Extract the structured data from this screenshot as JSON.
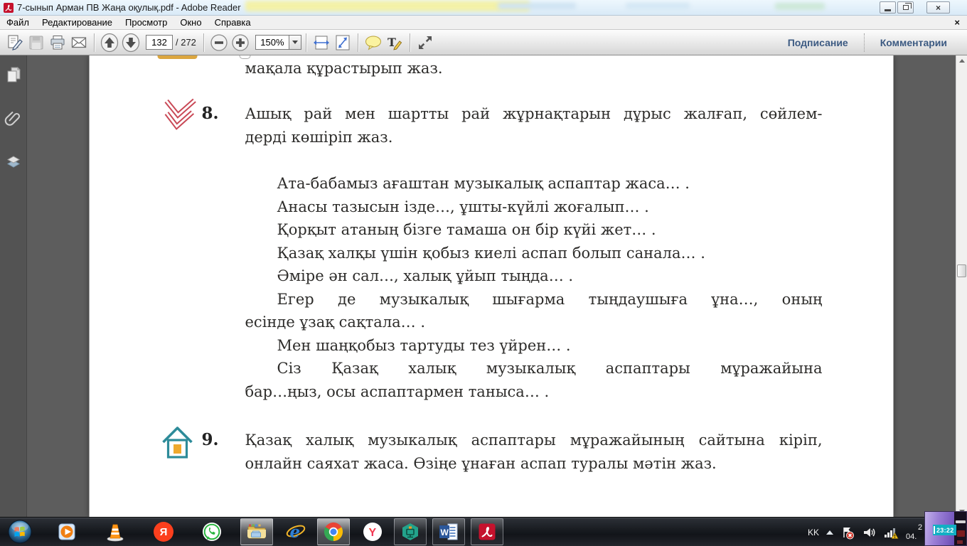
{
  "window": {
    "title": "7-сынып Арман ПВ Жаңа оқулық.pdf - Adobe Reader",
    "close_glyph": "×"
  },
  "menu": {
    "items": [
      "Файл",
      "Редактирование",
      "Просмотр",
      "Окно",
      "Справка"
    ],
    "close_glyph": "×"
  },
  "toolbar": {
    "page_current": "132",
    "page_total": "/ 272",
    "zoom_level": "150%",
    "signing_label": "Подписание",
    "comments_label": "Комментарии"
  },
  "document": {
    "partial_top_line": "мақала құрастырып жаз.",
    "exercise8": {
      "number": "8.",
      "intro": [
        {
          "text": "Ашық рай мен шартты рай жұрнақтарын дұрыс жалғап, сөйлем-"
        },
        {
          "text": "дерді көшіріп жаз."
        }
      ],
      "sentences": [
        {
          "text": "Ата-бабамыз ағаштан музыкалық аспаптар жаса… ."
        },
        {
          "text": "Анасы тазысын ізде…, ұшты-күйлі жоғалып… ."
        },
        {
          "text": "Қорқыт атаның бізге тамаша он бір күйі жет… ."
        },
        {
          "text": "Қазақ халқы үшін қобыз киелі аспап болып санала… ."
        },
        {
          "text": "Әміре ән сал…, халық ұйып тыңда… ."
        },
        {
          "text": "Егер де музыкалық шығарма тыңдаушыға ұна…, оның"
        },
        {
          "text": "есінде ұзақ сақтала… ."
        },
        {
          "text": "Мен шаңқобыз тартуды тез үйрен… ."
        },
        {
          "text": "Сіз Қазақ халық музыкалық аспаптары мұражайына"
        },
        {
          "text": "бар…ңыз,  осы аспаптармен таныса… ."
        }
      ]
    },
    "exercise9": {
      "number": "9.",
      "lines": [
        {
          "text": "Қазақ халық музыкалық аспаптары мұражайының сайтына кіріп,"
        },
        {
          "text": "онлайн саяхат жаса. Өзіңе ұнаған аспап туралы мәтін жаз."
        }
      ]
    }
  },
  "taskbar": {
    "language_indicator": "KK",
    "clock_time_partial": "2",
    "clock_date_partial": "04.",
    "pip_time": "23:22",
    "glyphs": {
      "yandex_browser": "Я",
      "internet_explorer": "e",
      "yandex_browser_2": "Y",
      "word": "W"
    }
  },
  "colors": {
    "exercise8_icon": "#c94a57",
    "exercise9_icon_outline": "#2d8b99",
    "exercise9_icon_window": "#efa92e",
    "pip_badge": "#12afc4",
    "taskbar_warning": "#f6c21d",
    "toolbar_labels": "#3c5a82"
  }
}
